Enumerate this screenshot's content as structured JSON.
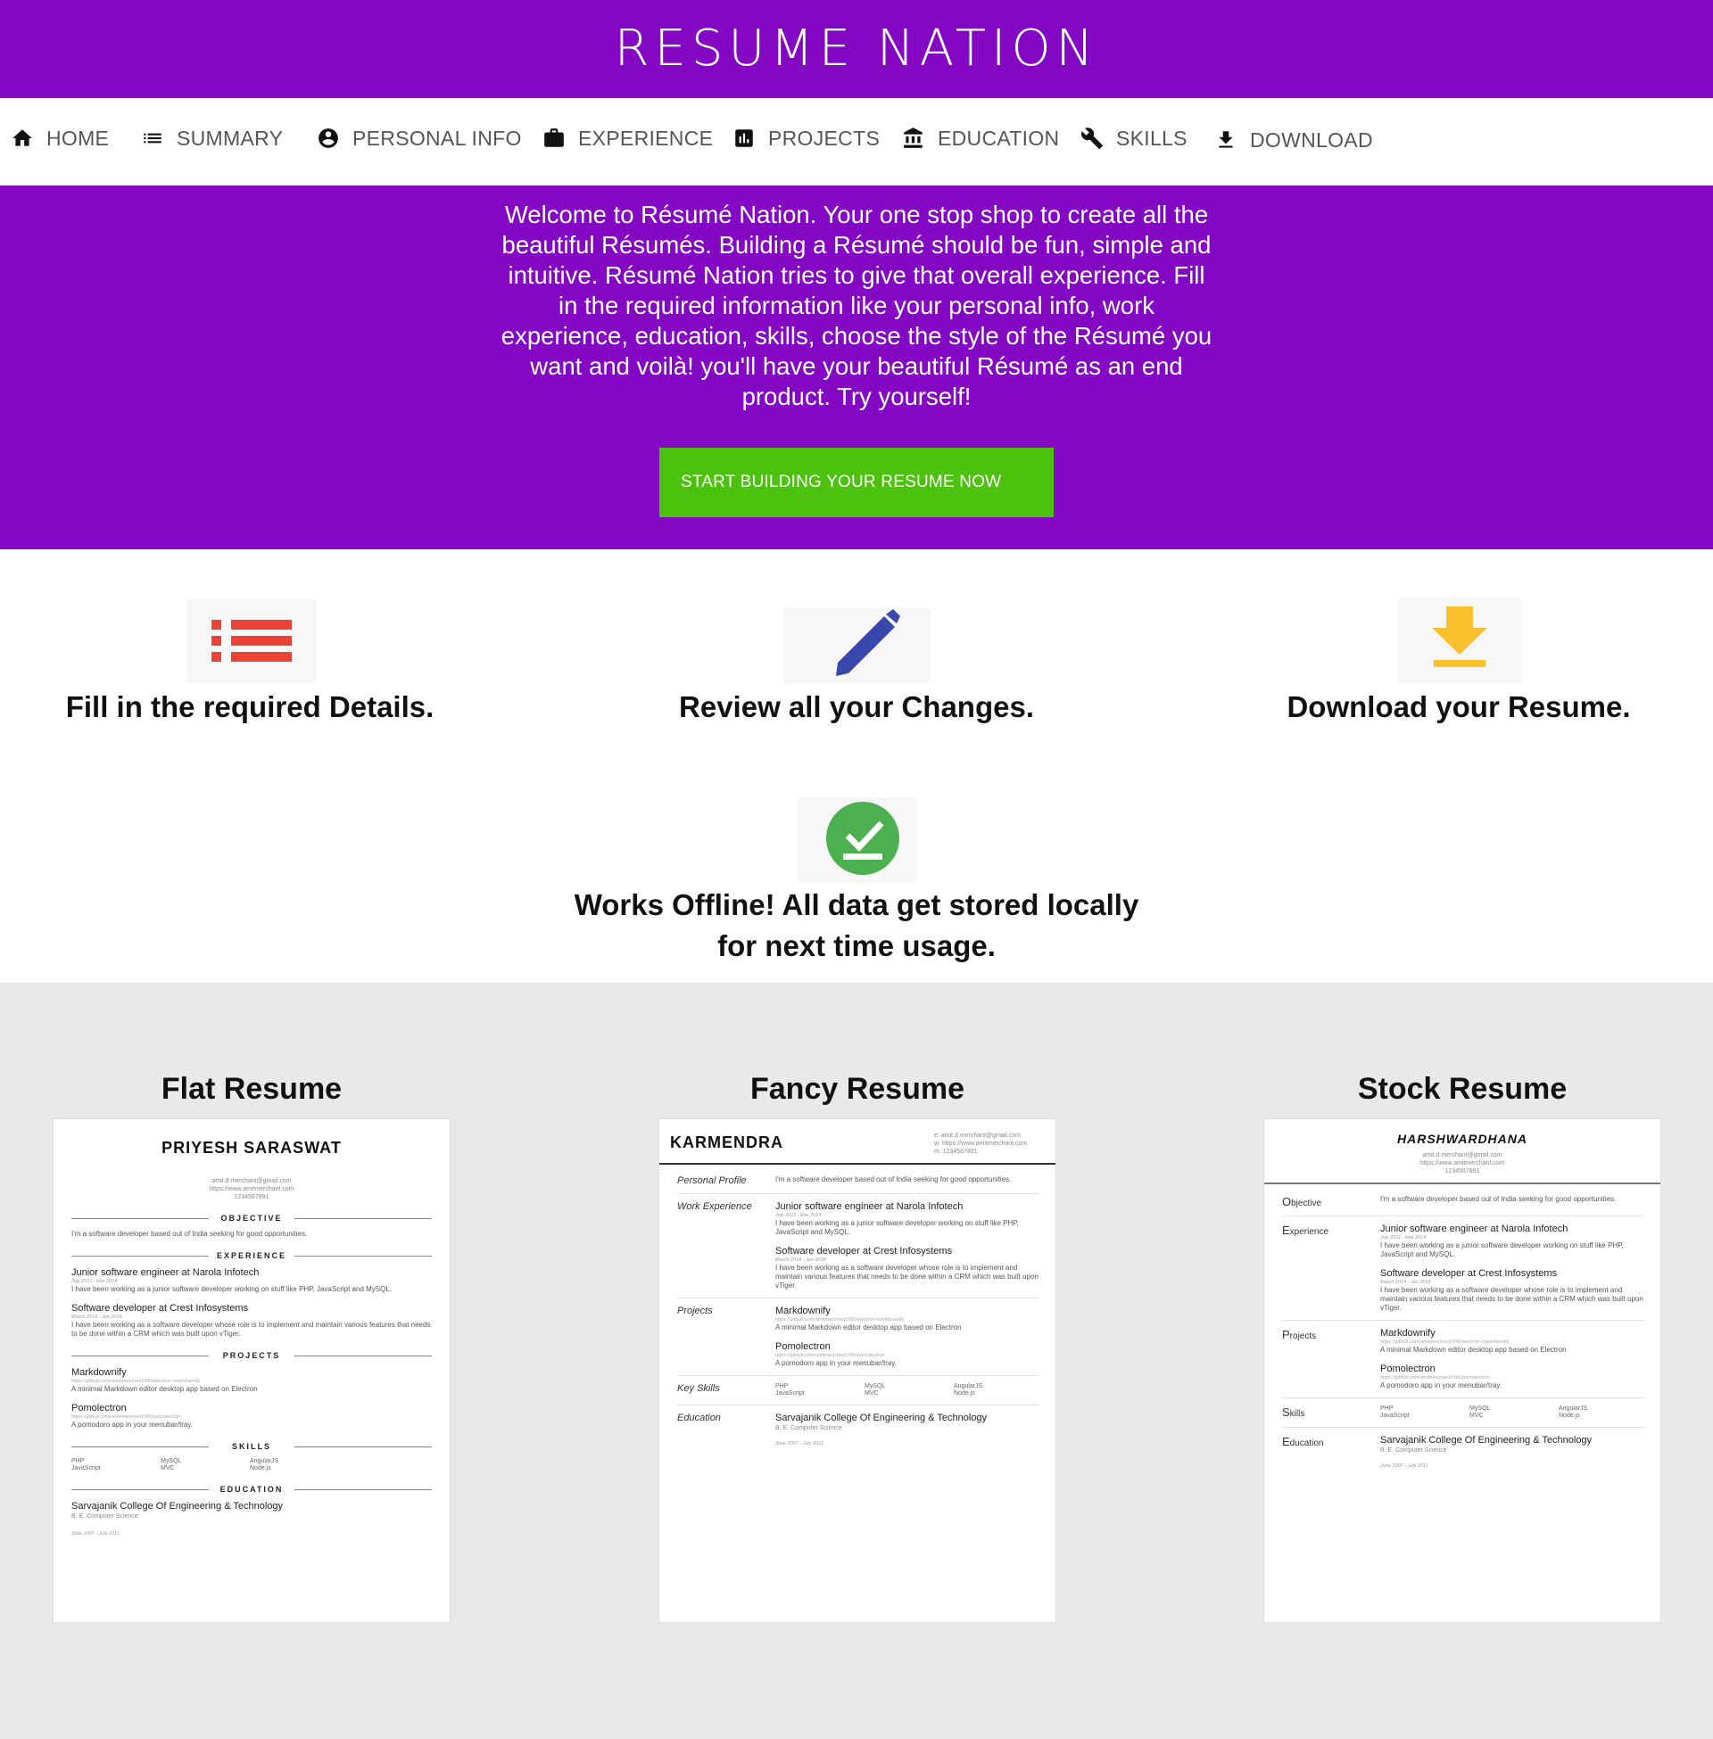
{
  "header": {
    "brand": "RESUME NATION"
  },
  "nav": {
    "items": [
      {
        "label": "HOME",
        "icon": "home-icon"
      },
      {
        "label": "SUMMARY",
        "icon": "list-icon"
      },
      {
        "label": "PERSONAL INFO",
        "icon": "account-circle-icon"
      },
      {
        "label": "EXPERIENCE",
        "icon": "briefcase-icon"
      },
      {
        "label": "PROJECTS",
        "icon": "bar-chart-icon"
      },
      {
        "label": "EDUCATION",
        "icon": "institution-icon"
      },
      {
        "label": "SKILLS",
        "icon": "wrench-icon"
      },
      {
        "label": "DOWNLOAD",
        "icon": "download-icon"
      }
    ]
  },
  "hero": {
    "text": "Welcome to Résumé Nation. Your one stop shop to create all the beautiful Résumés. Building a Résumé should be fun, simple and intuitive. Résumé Nation tries to give that overall experience. Fill in the required information like your personal info, work experience, education, skills, choose the style of the Résumé you want and voilà! you'll have your beautiful Résumé as an end product. Try yourself!",
    "cta": "START BUILDING YOUR RESUME NOW"
  },
  "features": [
    {
      "title": "Fill in the required Details.",
      "icon": "list-icon"
    },
    {
      "title": "Review all your Changes.",
      "icon": "pencil-icon"
    },
    {
      "title": "Download your Resume.",
      "icon": "download-icon"
    },
    {
      "title_line1": "Works Offline! All data get stored locally",
      "title_line2": "for next time usage.",
      "icon": "offline-check-icon"
    }
  ],
  "colors": {
    "brand": "#8407C4",
    "cta": "#4CC20F",
    "feature_list": "#EA4335",
    "feature_pencil": "#3949AB",
    "feature_download": "#FBC02D",
    "feature_offline": "#4CAF50",
    "gallery_bg": "#E9E9E9"
  },
  "gallery": {
    "templates": [
      {
        "title": "Flat Resume"
      },
      {
        "title": "Fancy Resume"
      },
      {
        "title": "Stock Resume"
      }
    ]
  },
  "sample": {
    "flat_name": "PRIYESH SARASWAT",
    "fancy_name": "KARMENDRA",
    "stock_name": "HARSHWARDHANA",
    "email": "amit.d.merchant@gmail.com",
    "website": "https://www.amitmerchant.com",
    "phone": "1234567891",
    "fancy_email": "e: amit.d.merchant@gmail.com",
    "fancy_website": "w: https://www.amitmerchant.com",
    "fancy_phone": "m: 1234567891",
    "objective_text": "I'm a software developer based out of India seeking for good opportunities.",
    "section_objective": "OBJECTIVE",
    "section_experience": "EXPERIENCE",
    "section_projects": "PROJECTS",
    "section_skills": "SKILLS",
    "section_education": "EDUCATION",
    "fancy_personal_profile": "Personal Profile",
    "fancy_work_experience": "Work Experience",
    "fancy_projects": "Projects",
    "fancy_key_skills": "Key Skills",
    "fancy_education": "Education",
    "stock_objective": "Objective",
    "stock_experience": "Experience",
    "stock_projects": "Projects",
    "stock_skills": "Skills",
    "stock_education": "Education",
    "job1_title": "Junior software engineer at Narola Infotech",
    "job1_dates": "July 2011 - Mar 2014",
    "job1_desc": "I have been working as a junior software developer working on stuff like PHP, JavaScript and MySQL.",
    "job2_title": "Software developer at Crest Infosystems",
    "job2_dates": "March 2014 - Jan 2018",
    "job2_desc": "I have been working as a software developer whose role is to implement and maintain various features that needs to be done within a CRM which was built upon vTiger.",
    "proj1_name": "Markdownify",
    "proj1_link": "https://github.com/amitmerchant1990/electron-markdownify",
    "proj1_desc": "A minimal Markdown editor desktop app based on Electron",
    "proj2_name": "Pomolectron",
    "proj2_link": "https://github.com/amitmerchant1990/pomolectron",
    "proj2_desc": "A pomodoro app in your menubar/tray.",
    "skill1a": "PHP",
    "skill1b": "JavaScript",
    "skill2a": "MySQL",
    "skill2b": "MVC",
    "skill3a": "AngularJS",
    "skill3b": "Node.js",
    "edu_school": "Sarvajanik College Of Engineering & Technology",
    "edu_degree": "B. E. Computer Science",
    "edu_dates": "June 2007 - July 2011"
  }
}
